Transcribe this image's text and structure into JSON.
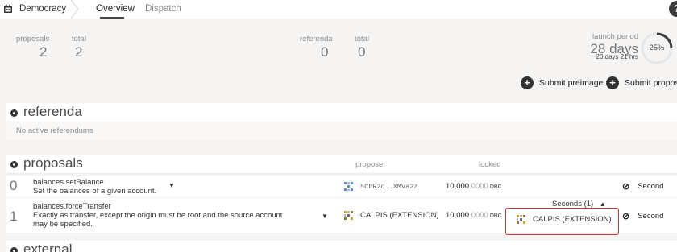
{
  "nav": {
    "section": "Democracy",
    "tabs": [
      "Overview",
      "Dispatch"
    ],
    "help": "?"
  },
  "summary": {
    "proposals_label": "proposals",
    "proposals_value": "2",
    "proposals_total_label": "total",
    "proposals_total_value": "2",
    "referenda_label": "referenda",
    "referenda_value": "0",
    "referenda_total_label": "total",
    "referenda_total_value": "0",
    "launch_label": "launch period",
    "launch_days_number": "28",
    "launch_days_unit": "days",
    "launch_detail": "20 days 21 hrs",
    "launch_progress_label": "25%",
    "launch_progress_fraction": 0.25
  },
  "actions": {
    "submit_preimage": "Submit preimage",
    "submit_proposal": "Submit proposal"
  },
  "referenda": {
    "title": "referenda",
    "empty": "No active referendums"
  },
  "proposals": {
    "title": "proposals",
    "columns": {
      "proposer": "proposer",
      "locked": "locked"
    },
    "rows": [
      {
        "index": "0",
        "call": "balances.setBalance",
        "description": "Set the balances of a given account.",
        "proposer": "5DhR2d..XMVa2z",
        "locked_int": "10,000.",
        "locked_dec": "0000",
        "locked_unit": "DBC",
        "action": "Second"
      },
      {
        "index": "1",
        "call": "balances.forceTransfer",
        "description": "Exactly as transfer, except the origin must be root and the source account may be specified.",
        "proposer": "CALPIS (EXTENSION)",
        "locked_int": "10,000.",
        "locked_dec": "0000",
        "locked_unit": "DBC",
        "seconds_label": "Seconds (1)",
        "seconder": "CALPIS (EXTENSION)",
        "action": "Second"
      }
    ]
  },
  "external": {
    "title": "external"
  },
  "colors": {
    "accent_highlight": "#d9342b",
    "dark": "#333333",
    "ring_track": "#e6e6e6",
    "ring_fill": "#3c3c3c"
  },
  "icons": [
    "calendar-icon",
    "chevron-right-icon",
    "help-icon",
    "plus-icon",
    "identicon",
    "link-icon",
    "caret-down-icon",
    "caret-up-icon"
  ]
}
